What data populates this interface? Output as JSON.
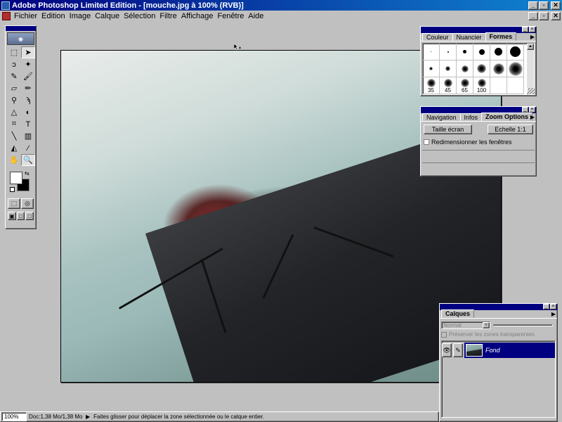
{
  "window": {
    "title": "Adobe Photoshop Limited Edition - [mouche.jpg à 100%  (RVB)]",
    "controls": [
      "_",
      "▫",
      "✕"
    ]
  },
  "menu": {
    "items": [
      "Fichier",
      "Edition",
      "Image",
      "Calque",
      "Sélection",
      "Filtre",
      "Affichage",
      "Fenêtre",
      "Aide"
    ],
    "doc_controls": [
      "_",
      "▫",
      "✕"
    ]
  },
  "document": {
    "file": "mouche.jpg",
    "zoom": "100%",
    "mode": "RVB"
  },
  "toolbox": {
    "tools": [
      {
        "name": "marquee-tool",
        "glyph": "⬚"
      },
      {
        "name": "move-tool",
        "glyph": "➤"
      },
      {
        "name": "lasso-tool",
        "glyph": "ↄ"
      },
      {
        "name": "magic-wand-tool",
        "glyph": "✦"
      },
      {
        "name": "airbrush-tool",
        "glyph": "✎"
      },
      {
        "name": "paintbrush-tool",
        "glyph": "🖌"
      },
      {
        "name": "eraser-tool",
        "glyph": "▱"
      },
      {
        "name": "pencil-tool",
        "glyph": "✏"
      },
      {
        "name": "rubber-stamp-tool",
        "glyph": "⚲"
      },
      {
        "name": "smudge-tool",
        "glyph": "ϡ"
      },
      {
        "name": "sharpen-tool",
        "glyph": "△"
      },
      {
        "name": "dodge-tool",
        "glyph": "◐"
      },
      {
        "name": "crop-tool",
        "glyph": "⌗"
      },
      {
        "name": "type-tool",
        "glyph": "T"
      },
      {
        "name": "line-tool",
        "glyph": "╲"
      },
      {
        "name": "gradient-tool",
        "glyph": "▥"
      },
      {
        "name": "paint-bucket-tool",
        "glyph": "◭"
      },
      {
        "name": "eyedropper-tool",
        "glyph": "⁄"
      },
      {
        "name": "hand-tool",
        "glyph": "✋"
      },
      {
        "name": "zoom-tool",
        "glyph": "🔍"
      }
    ],
    "foreground_color": "#ffffff",
    "background_color": "#000000"
  },
  "brushes_palette": {
    "tabs": [
      "Couleur",
      "Nuancier",
      "Formes"
    ],
    "active_tab": "Formes",
    "size_labels": [
      "35",
      "45",
      "65",
      "100"
    ]
  },
  "nav_palette": {
    "tabs": [
      "Navigation",
      "Infos",
      "Zoom Options"
    ],
    "active_tab": "Zoom Options",
    "btn_fit": "Taille écran",
    "btn_actual": "Echelle 1:1",
    "resize_label": "Redimensionner les fenêtres",
    "resize_checked": false
  },
  "layers_palette": {
    "tab": "Calques",
    "blend_mode": "Normal",
    "preserve_label": "Préserver les zones transparentes",
    "layers": [
      {
        "name": "Fond",
        "visible": true,
        "selected": true
      }
    ]
  },
  "statusbar": {
    "zoom": "100%",
    "doc_size": "Doc:1,38 Mo/1,38 Mo",
    "hint": "Faites glisser pour déplacer la zone sélectionnée ou le calque entier."
  },
  "colors": {
    "titlebar_start": "#000080",
    "titlebar_end": "#1084d0",
    "chrome": "#c0c0c0",
    "selection": "#000080"
  }
}
